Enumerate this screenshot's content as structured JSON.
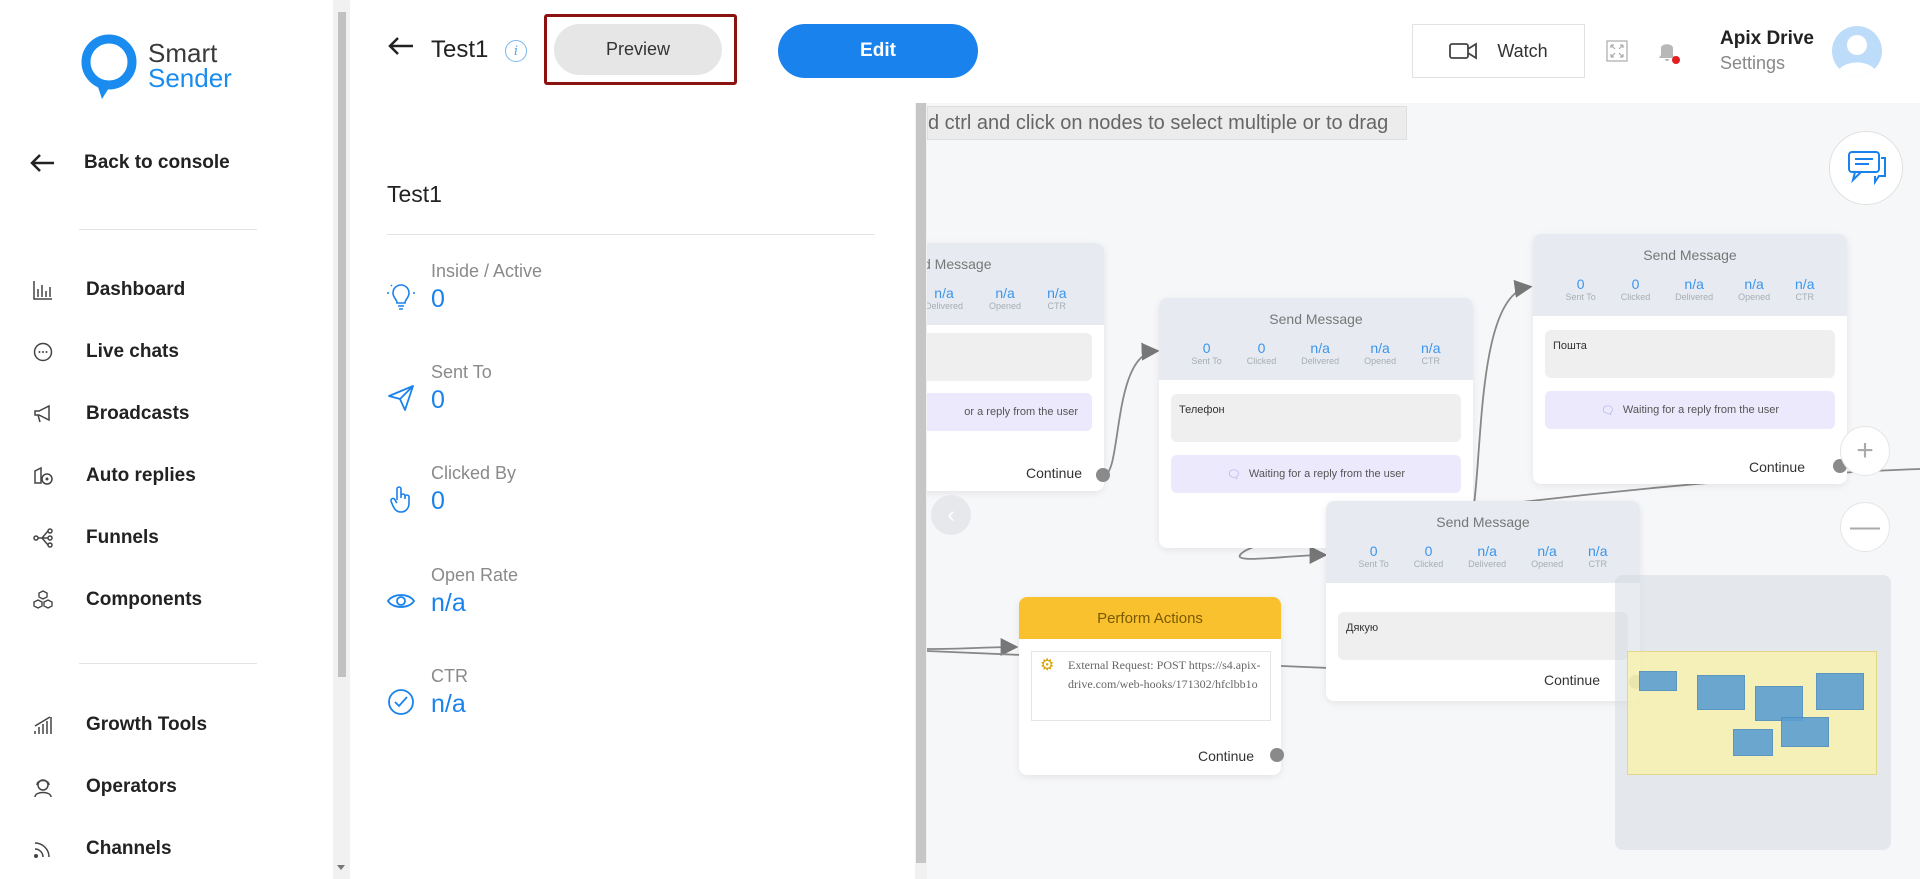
{
  "brand": {
    "line1": "Smart",
    "line2": "Sender"
  },
  "sidebar": {
    "back_label": "Back to console",
    "items": [
      {
        "label": "Dashboard",
        "icon": "dashboard-icon"
      },
      {
        "label": "Live chats",
        "icon": "chat-bubble-icon"
      },
      {
        "label": "Broadcasts",
        "icon": "megaphone-icon"
      },
      {
        "label": "Auto replies",
        "icon": "auto-reply-icon"
      },
      {
        "label": "Funnels",
        "icon": "funnel-icon"
      },
      {
        "label": "Components",
        "icon": "cubes-icon"
      }
    ],
    "items2": [
      {
        "label": "Growth Tools",
        "icon": "growth-bars-icon"
      },
      {
        "label": "Operators",
        "icon": "operator-icon"
      },
      {
        "label": "Channels",
        "icon": "rss-icon"
      }
    ]
  },
  "header": {
    "title": "Test1",
    "preview_label": "Preview",
    "edit_label": "Edit",
    "watch_label": "Watch",
    "account_name": "Apix Drive",
    "account_settings": "Settings"
  },
  "panel": {
    "title": "Test1",
    "stats": [
      {
        "label": "Inside / Active",
        "value": "0",
        "icon": "lightbulb-icon"
      },
      {
        "label": "Sent To",
        "value": "0",
        "icon": "paper-plane-icon"
      },
      {
        "label": "Clicked By",
        "value": "0",
        "icon": "pointer-hand-icon"
      },
      {
        "label": "Open Rate",
        "value": "n/a",
        "icon": "eye-icon"
      },
      {
        "label": "CTR",
        "value": "n/a",
        "icon": "check-circle-icon"
      }
    ]
  },
  "canvas": {
    "hint": "d ctrl and click on nodes to select multiple or to drag",
    "stat_keys": {
      "sent": "Sent To",
      "clicked": "Clicked",
      "delivered": "Delivered",
      "opened": "Opened",
      "ctr": "CTR"
    },
    "nodes": [
      {
        "title": "d Message",
        "sent": "",
        "clicked": "",
        "delivered": "n/a",
        "opened": "n/a",
        "ctr": "n/a",
        "message": "",
        "wait": "or a reply from the user",
        "continue": "Continue"
      },
      {
        "title": "Send Message",
        "sent": "0",
        "clicked": "0",
        "delivered": "n/a",
        "opened": "n/a",
        "ctr": "n/a",
        "message": "Телефон",
        "wait": "Waiting for a reply from the user",
        "continue": "Continue"
      },
      {
        "title": "Send Message",
        "sent": "0",
        "clicked": "0",
        "delivered": "n/a",
        "opened": "n/a",
        "ctr": "n/a",
        "message": "Пошта",
        "wait": "Waiting for a reply from the user",
        "continue": "Continue"
      },
      {
        "title": "Send Message",
        "sent": "0",
        "clicked": "0",
        "delivered": "n/a",
        "opened": "n/a",
        "ctr": "n/a",
        "message": "Дякую",
        "continue": "Continue"
      }
    ],
    "action": {
      "title": "Perform Actions",
      "request": "External Request: POST https://s4.apix-drive.com/web-hooks/171302/hfclbb1o",
      "continue": "Continue"
    }
  }
}
